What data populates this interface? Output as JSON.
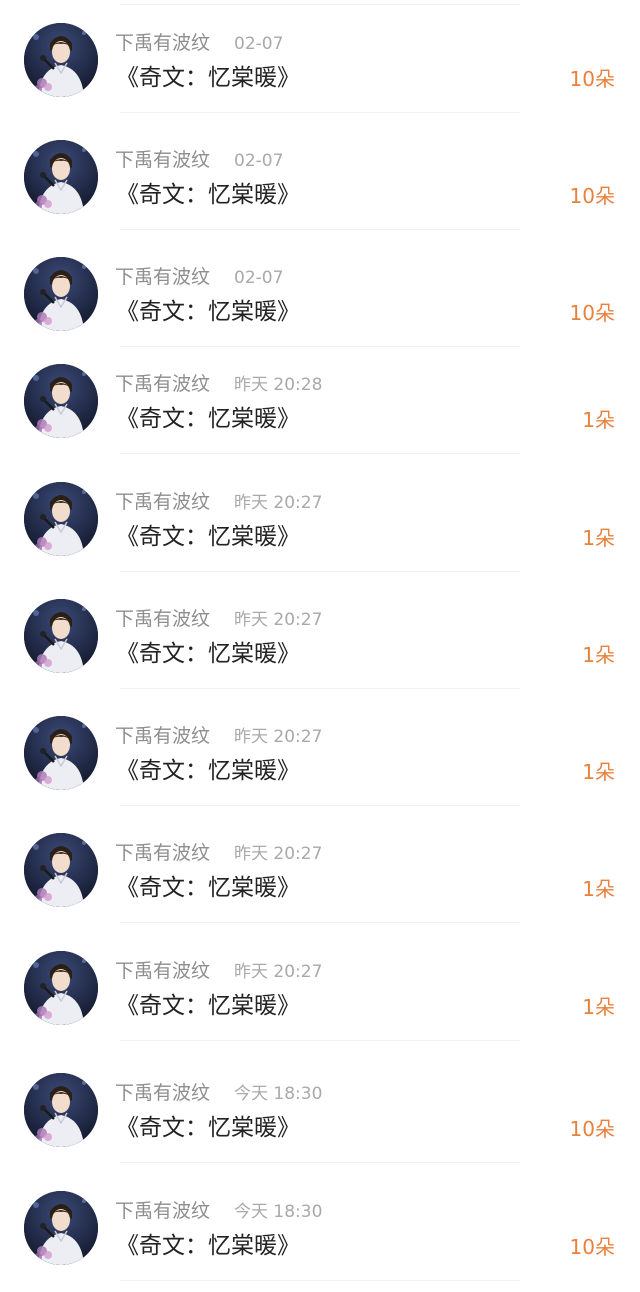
{
  "gift_color": "#e8813c",
  "records": [
    {
      "name": "下禹有波纹",
      "time": "02-07",
      "title": "《奇文：忆棠暖》",
      "gift": "10朵"
    },
    {
      "name": "下禹有波纹",
      "time": "02-07",
      "title": "《奇文：忆棠暖》",
      "gift": "10朵"
    },
    {
      "name": "下禹有波纹",
      "time": "02-07",
      "title": "《奇文：忆棠暖》",
      "gift": "10朵"
    },
    {
      "name": "下禹有波纹",
      "time": "昨天 20:28",
      "title": "《奇文：忆棠暖》",
      "gift": "1朵"
    },
    {
      "name": "下禹有波纹",
      "time": "昨天 20:27",
      "title": "《奇文：忆棠暖》",
      "gift": "1朵"
    },
    {
      "name": "下禹有波纹",
      "time": "昨天 20:27",
      "title": "《奇文：忆棠暖》",
      "gift": "1朵"
    },
    {
      "name": "下禹有波纹",
      "time": "昨天 20:27",
      "title": "《奇文：忆棠暖》",
      "gift": "1朵"
    },
    {
      "name": "下禹有波纹",
      "time": "昨天 20:27",
      "title": "《奇文：忆棠暖》",
      "gift": "1朵"
    },
    {
      "name": "下禹有波纹",
      "time": "昨天 20:27",
      "title": "《奇文：忆棠暖》",
      "gift": "1朵"
    },
    {
      "name": "下禹有波纹",
      "time": "今天 18:30",
      "title": "《奇文：忆棠暖》",
      "gift": "10朵"
    },
    {
      "name": "下禹有波纹",
      "time": "今天 18:30",
      "title": "《奇文：忆棠暖》",
      "gift": "10朵"
    }
  ]
}
